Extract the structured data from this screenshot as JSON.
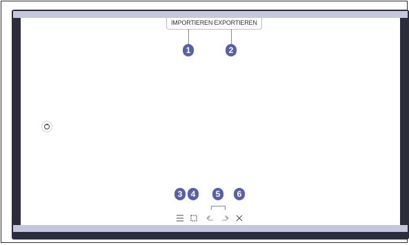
{
  "top_menu": {
    "import_label": "IMPORTIEREN",
    "export_label": "EXPORTIEREN"
  },
  "callouts": [
    "1",
    "2",
    "3",
    "4",
    "5",
    "6"
  ],
  "toolbar": {
    "menu_icon": "hamburger-menu-icon",
    "select_icon": "selection-icon",
    "undo_icon": "undo-icon",
    "redo_icon": "redo-icon",
    "close_icon": "close-icon"
  },
  "colors": {
    "callout": "#595fa8",
    "frame": "#2b2d3c",
    "bar": "#c5c8dc"
  }
}
